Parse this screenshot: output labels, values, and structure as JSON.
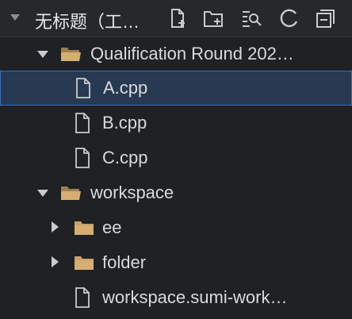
{
  "panel": {
    "title": "无标题（工…",
    "toolbar": [
      {
        "name": "new-file-icon"
      },
      {
        "name": "new-folder-icon"
      },
      {
        "name": "search-folder-icon"
      },
      {
        "name": "refresh-icon"
      },
      {
        "name": "collapse-all-icon"
      }
    ]
  },
  "tree": {
    "qualification_folder": "Qualification Round 202…",
    "a_file": "A.cpp",
    "b_file": "B.cpp",
    "c_file": "C.cpp",
    "workspace_folder": "workspace",
    "ee_folder": "ee",
    "folder_folder": "folder",
    "workspace_file": "workspace.sumi-work…"
  },
  "colors": {
    "background": "#1f2124",
    "selection": "#273a52",
    "selection_border": "#3b6fbf",
    "folder": "#c9a26a"
  }
}
